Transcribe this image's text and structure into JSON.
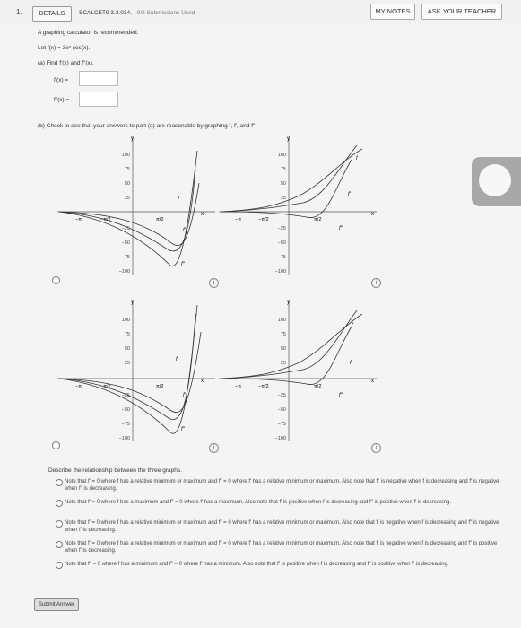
{
  "question_number": "1.",
  "header": {
    "details_label": "DETAILS",
    "reference": "SCALCET9 3.3.034.",
    "submissions": "0/2 Submissions Used",
    "my_notes": "MY NOTES",
    "ask_teacher": "ASK YOUR TEACHER"
  },
  "intro": "A graphing calculator is recommended.",
  "function_def": "Let f(x) = 3eˣ cos(x).",
  "part_a": {
    "prompt": "(a)  Find f′(x) and f″(x).",
    "f1_label": "f′(x) =",
    "f2_label": "f″(x) =",
    "f1_value": "",
    "f2_value": ""
  },
  "part_b": {
    "prompt": "(b)  Check to see that your answers to part (a) are reasonable by graphing f, f′, and f″.",
    "axis_y_label": "y",
    "axis_x_label": "x",
    "ticks_y": [
      "100",
      "75",
      "50",
      "25",
      "−25",
      "−50",
      "−75",
      "−100"
    ],
    "tick_x_neg_pi": "−π",
    "tick_x_neg_half_pi": "−π/2",
    "tick_x_half_pi": "π/2",
    "curve_labels": [
      "f",
      "f′",
      "f″"
    ],
    "info_icon_label": "i"
  },
  "describe": {
    "prompt": "Describe the relationship between the three graphs.",
    "options": [
      "Note that f′ = 0 where f has a relative minimum or maximum and f″ = 0 where f′ has a relative minimum or maximum. Also note that f″ is negative when f is decreasing and f′ is negative when f″ is decreasing.",
      "Note that f′ = 0 where f has a maximum and f″ = 0 where f′ has a maximum. Also note that f′ is positive when f is decreasing and f″ is positive when f′ is decreasing.",
      "Note that f′ = 0 where f has a relative minimum or maximum and f″ = 0 where f′ has a relative minimum or maximum. Also note that f′ is negative when f is decreasing and f″ is negative when f′ is decreasing.",
      "Note that f′ = 0 where f has a relative minimum or maximum and f″ = 0 where f′ has a relative minimum or maximum. Also note that f′ is negative when f is decreasing and f″ is positive when f′ is decreasing.",
      "Note that f″ = 0 where f has a minimum and f″ = 0 where f′ has a minimum. Also note that f′ is positive when f is decreasing and f″ is positive when f′ is decreasing."
    ]
  },
  "submit_label": "Submit Answer"
}
